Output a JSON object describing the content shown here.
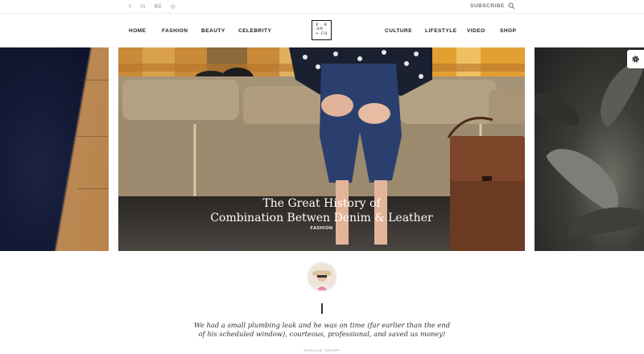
{
  "social": [
    {
      "icon": "twitter-icon",
      "glyph": "𝕥"
    },
    {
      "icon": "linkedin-icon",
      "glyph": "in"
    },
    {
      "icon": "behance-icon",
      "glyph": "Bē"
    },
    {
      "icon": "dribbble-icon",
      "glyph": "◎"
    }
  ],
  "topbar": {
    "subscribe_label": "SUBSCRIBE"
  },
  "nav": {
    "left": [
      "HOME",
      "FASHION",
      "BEAUTY",
      "CELEBRITY"
    ],
    "right": [
      "CULTURE",
      "LIFESTYLE",
      "VIDEO",
      "SHOP"
    ]
  },
  "logo": {
    "line1": "F · R",
    "line2": "AN · ",
    "line3": "+ CO"
  },
  "slider": {
    "title_line1": "The Great History of",
    "title_line2": "Combination Betwen Denim & Leather",
    "category": "FASHION"
  },
  "testimonial": {
    "quote": "We had a small plumbing leak and he was on time (far earlier than the end of his scheduled window), courteous, professional, and saved us money!",
    "author": "- DONALD TRUMP -"
  },
  "colors": {
    "accent": "#111111",
    "muted": "#9a9a9a"
  }
}
